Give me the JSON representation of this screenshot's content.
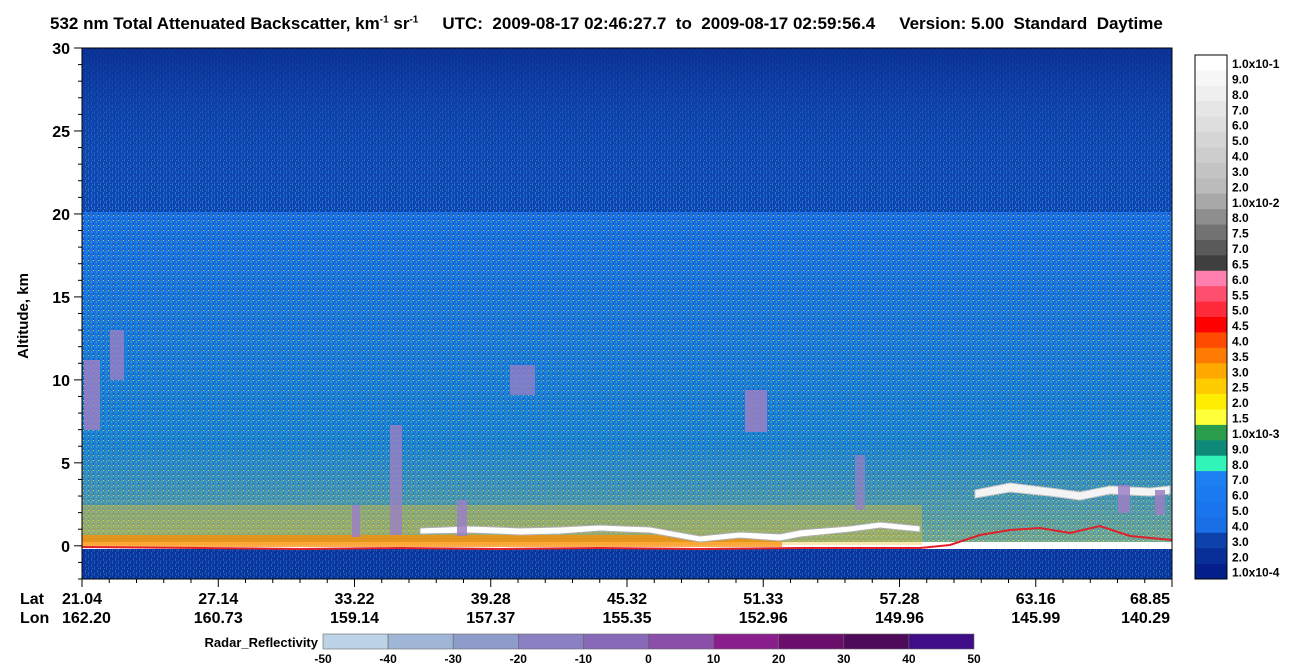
{
  "chart_data": {
    "type": "heatmap",
    "title": {
      "product": "532 nm Total Attenuated Backscatter, km",
      "unit_exp1": "-1",
      "unit_sr": " sr",
      "unit_exp2": "-1",
      "utc_label": "UTC:",
      "utc_start": "2009-08-17 02:46:27.7",
      "to_word": "to",
      "utc_end": "2009-08-17 02:59:56.4",
      "version": "Version: 5.00",
      "processing": "Standard",
      "daytime": "Daytime"
    },
    "ylabel": "Altitude, km",
    "ylim": [
      -2,
      30
    ],
    "yticks": [
      "30",
      "25",
      "20",
      "15",
      "10",
      "5",
      "0"
    ],
    "x_axis": {
      "lat_label": "Lat",
      "lon_label": "Lon",
      "lat": [
        "21.04",
        "27.14",
        "33.22",
        "39.28",
        "45.32",
        "51.33",
        "57.28",
        "63.16",
        "68.85"
      ],
      "lon": [
        "162.20",
        "160.73",
        "159.14",
        "157.37",
        "155.35",
        "152.96",
        "149.96",
        "145.99",
        "140.29"
      ]
    },
    "backscatter_colorbar": {
      "labels": [
        "1.0x10-1",
        "9.0",
        "8.0",
        "7.0",
        "6.0",
        "5.0",
        "4.0",
        "3.0",
        "2.0",
        "1.0x10-2",
        "8.0",
        "7.5",
        "7.0",
        "6.5",
        "6.0",
        "5.5",
        "5.0",
        "4.5",
        "4.0",
        "3.5",
        "3.0",
        "2.5",
        "2.0",
        "1.5",
        "1.0x10-3",
        "9.0",
        "8.0",
        "7.0",
        "6.0",
        "5.0",
        "4.0",
        "3.0",
        "2.0",
        "1.0x10-4"
      ],
      "colors": [
        "#ffffff",
        "#f7f7f7",
        "#efefef",
        "#e6e6e6",
        "#dedede",
        "#d6d6d6",
        "#cdcdcd",
        "#c4c4c4",
        "#bbbbbb",
        "#a8a8a8",
        "#8e8e8e",
        "#737373",
        "#5a5a5a",
        "#3f3f3f",
        "#ff7fae",
        "#ff4f6f",
        "#ff2a3a",
        "#ff0000",
        "#ff4b00",
        "#ff7a00",
        "#ffa800",
        "#ffcc00",
        "#ffee00",
        "#ffff3a",
        "#2b9e4d",
        "#0f8a7a",
        "#31f5b8",
        "#1c7ff2",
        "#1b7af0",
        "#1a74ee",
        "#1a6ee6",
        "#0c42aa",
        "#082f98",
        "#041f8a"
      ]
    },
    "radar_colorbar": {
      "label": "Radar_Reflectivity",
      "ticks": [
        "-50",
        "-40",
        "-30",
        "-20",
        "-10",
        "0",
        "10",
        "20",
        "30",
        "40",
        "50"
      ],
      "colors": [
        "#bcd3e8",
        "#9fb6d6",
        "#8e9ccc",
        "#8a80c2",
        "#8769b8",
        "#8a4fa8",
        "#8a1e8c",
        "#6c0f6c",
        "#4e0b5a",
        "#3f0d86"
      ]
    },
    "surface_line_color": "#e0202a",
    "cloud_color": "#ffffff",
    "background_noise_color": "#0b3a9a"
  }
}
